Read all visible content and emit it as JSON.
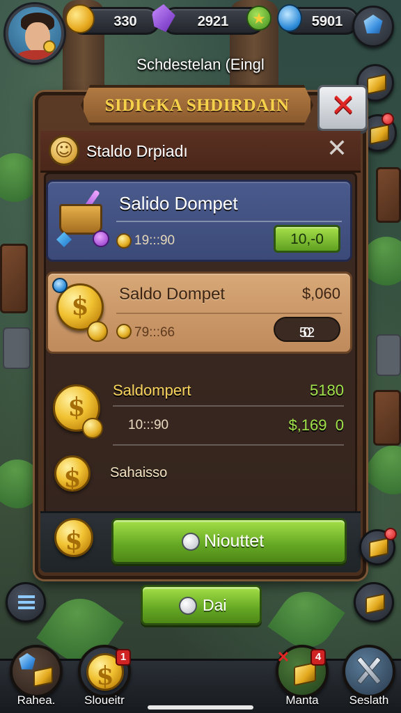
{
  "hud": {
    "coins": "330",
    "gems": "2921",
    "energy": "5901"
  },
  "location_title": "Schdestelan (Eingl",
  "panel": {
    "banner_title": "SIDIGKA SHDIRDAIN",
    "header_title": "Staldo Drpiadı",
    "offers": [
      {
        "title": "Salido Dompet",
        "sub_value": "19:::90",
        "button_label": "10,-0"
      },
      {
        "title": "Saldo Dompet",
        "price": "$,060",
        "sub_value": "79:::66",
        "pill_label": "52",
        "pill_suffix": "0"
      },
      {
        "title": "Saldompert",
        "price": "5180",
        "sub_value": "10:::90",
        "price_2": "$,169",
        "price_2_suffix": "0"
      },
      {
        "title": "Sahaisso"
      }
    ],
    "main_button_label": "Niouttet"
  },
  "secondary_button_label": "Dai",
  "nav": [
    {
      "label": "Rahea."
    },
    {
      "label": "Sloueitr",
      "badge": "1"
    },
    {
      "label": "Manta",
      "badge": "4"
    },
    {
      "label": "Seslath"
    }
  ],
  "colors": {
    "accent_gold": "#f6d24a",
    "button_green": "#64a723",
    "price_green": "#9fe24a",
    "close_red": "#e02525"
  },
  "icons": {
    "coin": "coin-icon",
    "gem": "purple-gem-icon",
    "energy": "green-star-icon",
    "bulb": "blue-bulb-icon",
    "close": "close-icon"
  }
}
